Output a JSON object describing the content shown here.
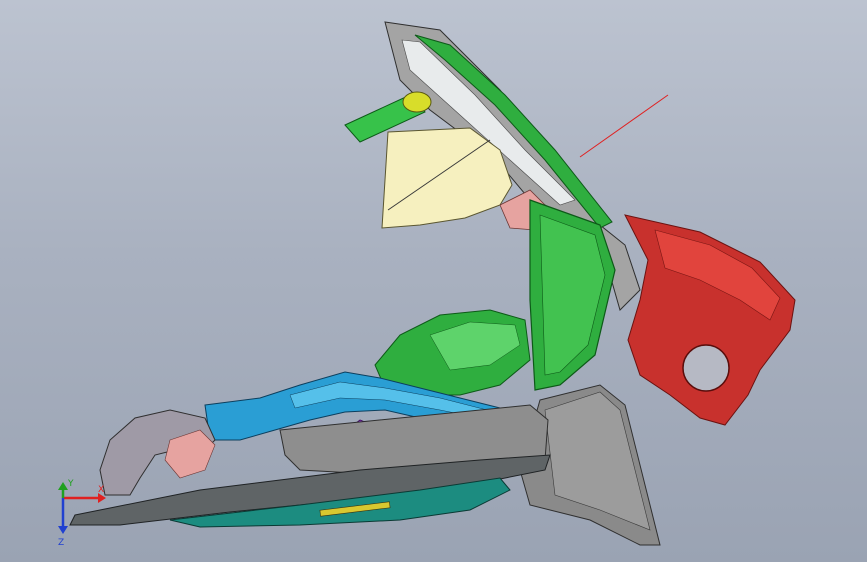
{
  "viewport": {
    "background_top": "#bcc3d0",
    "background_bottom": "#9aa3b3"
  },
  "model": {
    "part_colors": {
      "red_housing": "#c8312d",
      "green_panel": "#2fae3f",
      "blue_duct": "#2a9ed4",
      "yellow_panel": "#f6f0bf",
      "gray_body": "#8a8a8a",
      "dark_floor": "#5f6466",
      "teal_floor": "#1c8c80",
      "purple_part": "#9a3ad8",
      "pink_part": "#e6a3a0",
      "gray_hub": "#9f9aa6"
    }
  },
  "triad": {
    "x_label": "X",
    "y_label": "Y",
    "z_label": "Z",
    "x_color": "#e02020",
    "y_color": "#20a020",
    "z_color": "#2040d0"
  }
}
